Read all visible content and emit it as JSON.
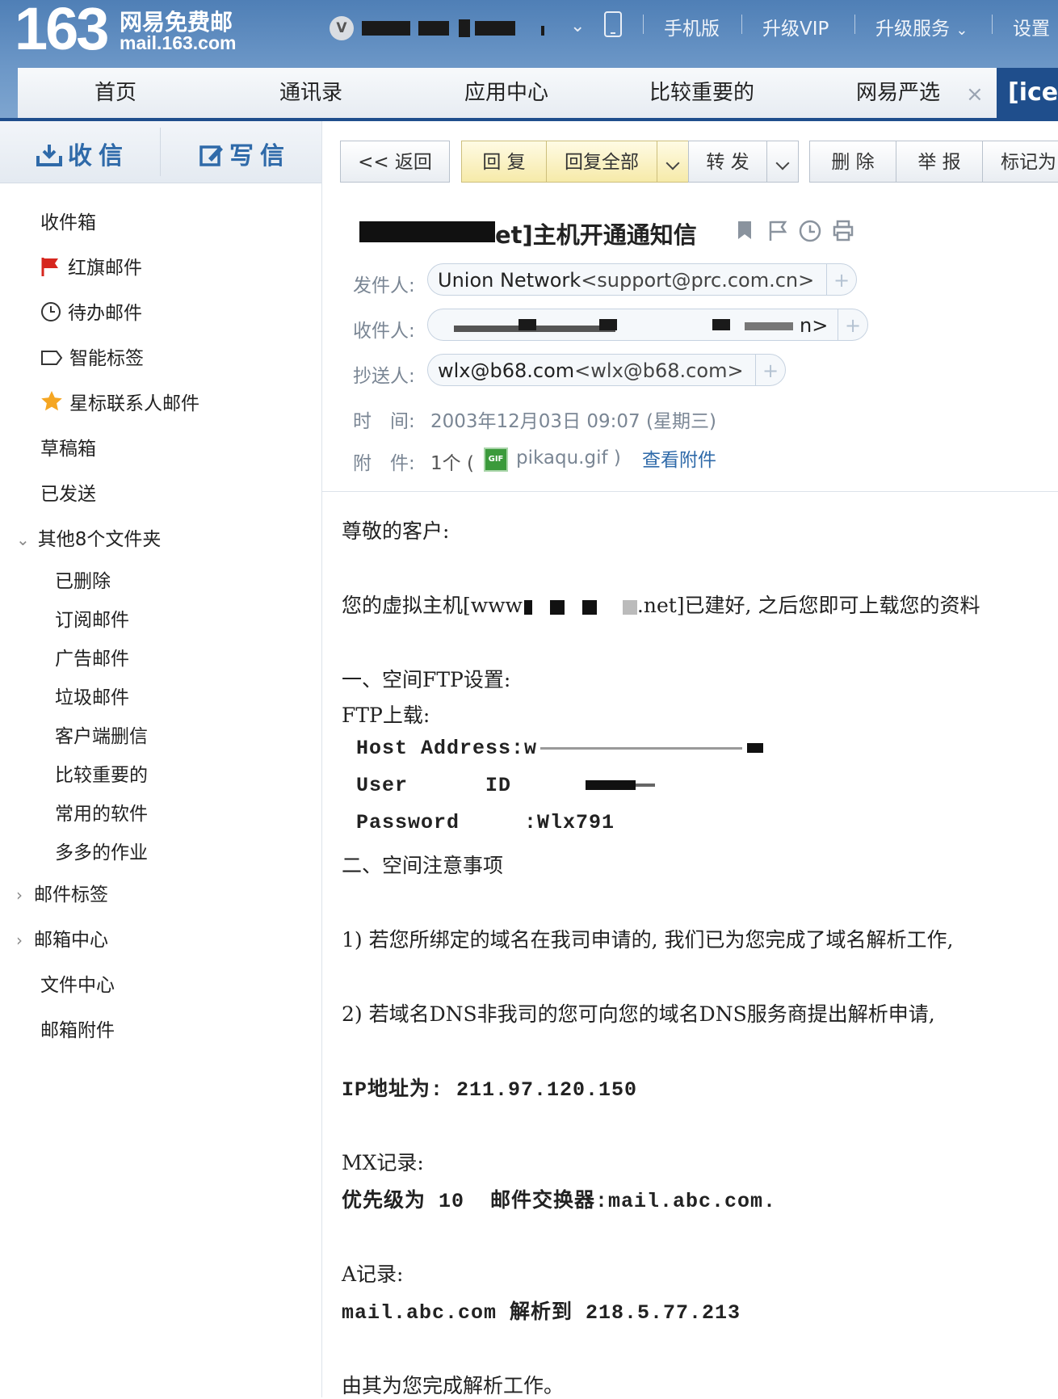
{
  "header": {
    "logo_number": "163",
    "logo_name": "网易免费邮",
    "logo_domain": "mail.163.com",
    "vip_badge": "V",
    "nav": [
      "手机版",
      "升级VIP",
      "升级服务",
      "设置"
    ],
    "tabs": [
      "首页",
      "通讯录",
      "应用中心",
      "比较重要的",
      "网易严选"
    ],
    "active_tab": "[ice",
    "tab_close": "×"
  },
  "sidebar": {
    "receive": "收信",
    "write": "写信",
    "folders": [
      "收件箱",
      "红旗邮件",
      "待办邮件",
      "智能标签",
      "星标联系人邮件",
      "草稿箱",
      "已发送"
    ],
    "other_group": "其他8个文件夹",
    "other_folders": [
      "已删除",
      "订阅邮件",
      "广告邮件",
      "垃圾邮件",
      "客户端删信",
      "比较重要的",
      "常用的软件",
      "多多的作业"
    ],
    "bottom": [
      "邮件标签",
      "邮箱中心",
      "文件中心",
      "邮箱附件"
    ]
  },
  "toolbar": {
    "back": "<< 返回",
    "reply": "回 复",
    "reply_all": "回复全部",
    "forward": "转 发",
    "delete": "删 除",
    "report": "举 报",
    "mark": "标记为"
  },
  "message": {
    "subject": "et]主机开通通知信",
    "from_label": "发件人:",
    "from_name": "Union Network",
    "from_addr": "<support@prc.com.cn>",
    "to_label": "收件人:",
    "to_tail": "n>",
    "cc_label": "抄送人:",
    "cc_name": "wlx@b68.com",
    "cc_addr": "<wlx@b68.com>",
    "time_label": "时　间:",
    "time_value": "2003年12月03日 09:07 (星期三)",
    "attach_label": "附　件:",
    "attach_count": "1个 (",
    "attach_name": "pikaqu.gif )",
    "attach_link": "查看附件",
    "gif_badge": "GIF"
  },
  "body": {
    "greeting": "尊敬的客户:",
    "intro_a": "您的虚拟主机[www",
    "intro_b": ".net]已建好, 之后您即可上载您的资料",
    "ftp_section": "一、空间FTP设置:",
    "ftp_upload": "FTP上载:",
    "host_label": "Host Address:w",
    "user_label": "User      ID",
    "password_line": "Password     :Wlx791",
    "notes_section": "二、空间注意事项",
    "note1": "1) 若您所绑定的域名在我司申请的, 我们已为您完成了域名解析工作,",
    "note2": "2) 若域名DNS非我司的您可向您的域名DNS服务商提出解析申请,",
    "ip_line": "IP地址为: 211.97.120.150",
    "mx_title": "MX记录:",
    "mx_line": "优先级为 10  邮件交换器:mail.abc.com.",
    "a_title": "A记录:",
    "a_line": "mail.abc.com 解析到 218.5.77.213",
    "closing": "由其为您完成解析工作。"
  }
}
